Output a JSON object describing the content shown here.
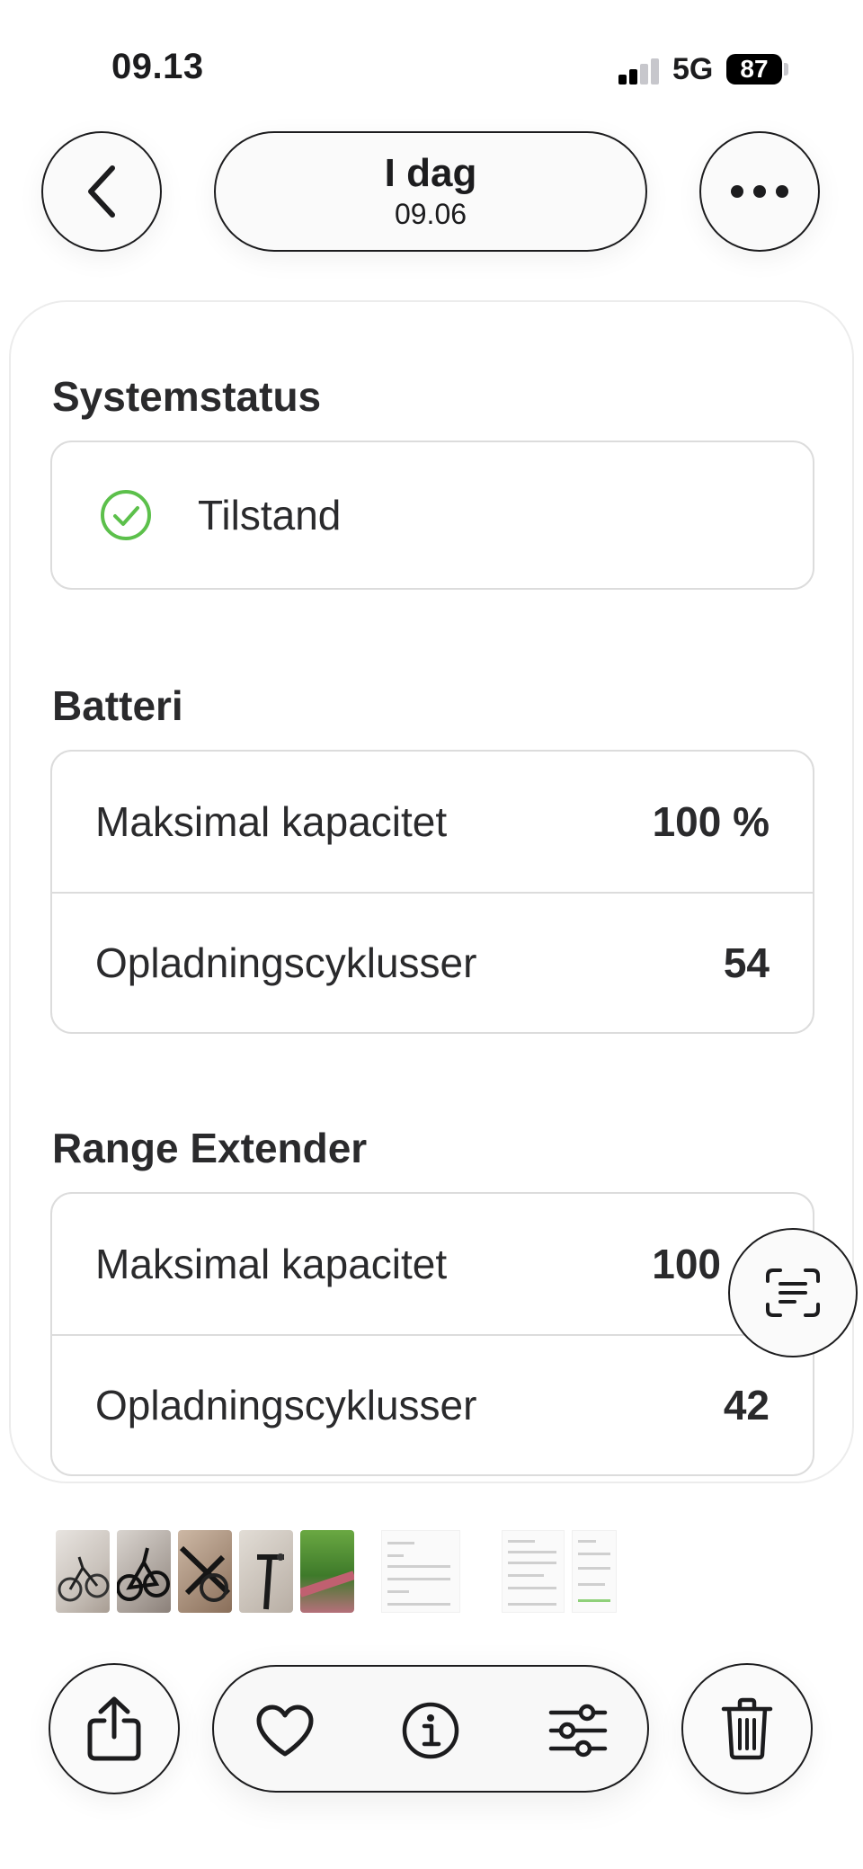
{
  "status_bar": {
    "time": "09.13",
    "network": "5G",
    "battery": "87"
  },
  "header": {
    "title": "I dag",
    "subtitle": "09.06"
  },
  "sections": {
    "system": {
      "heading": "Systemstatus",
      "status_label": "Tilstand",
      "status_color": "#5cc04b"
    },
    "battery": {
      "heading": "Batteri",
      "rows": [
        {
          "label": "Maksimal kapacitet",
          "value": "100 %"
        },
        {
          "label": "Opladningscyklusser",
          "value": "54"
        }
      ]
    },
    "range_extender": {
      "heading": "Range Extender",
      "rows": [
        {
          "label": "Maksimal kapacitet",
          "value": "100"
        },
        {
          "label": "Opladningscyklusser",
          "value": "42"
        }
      ]
    }
  },
  "icons": {
    "back": "chevron-left-icon",
    "more": "ellipsis-icon",
    "live_text": "live-text-icon",
    "share": "share-icon",
    "favorite": "heart-icon",
    "info": "info-icon",
    "adjust": "sliders-icon",
    "delete": "trash-icon"
  },
  "colors": {
    "accent_green": "#5cc04b",
    "text": "#1c1c1e"
  }
}
